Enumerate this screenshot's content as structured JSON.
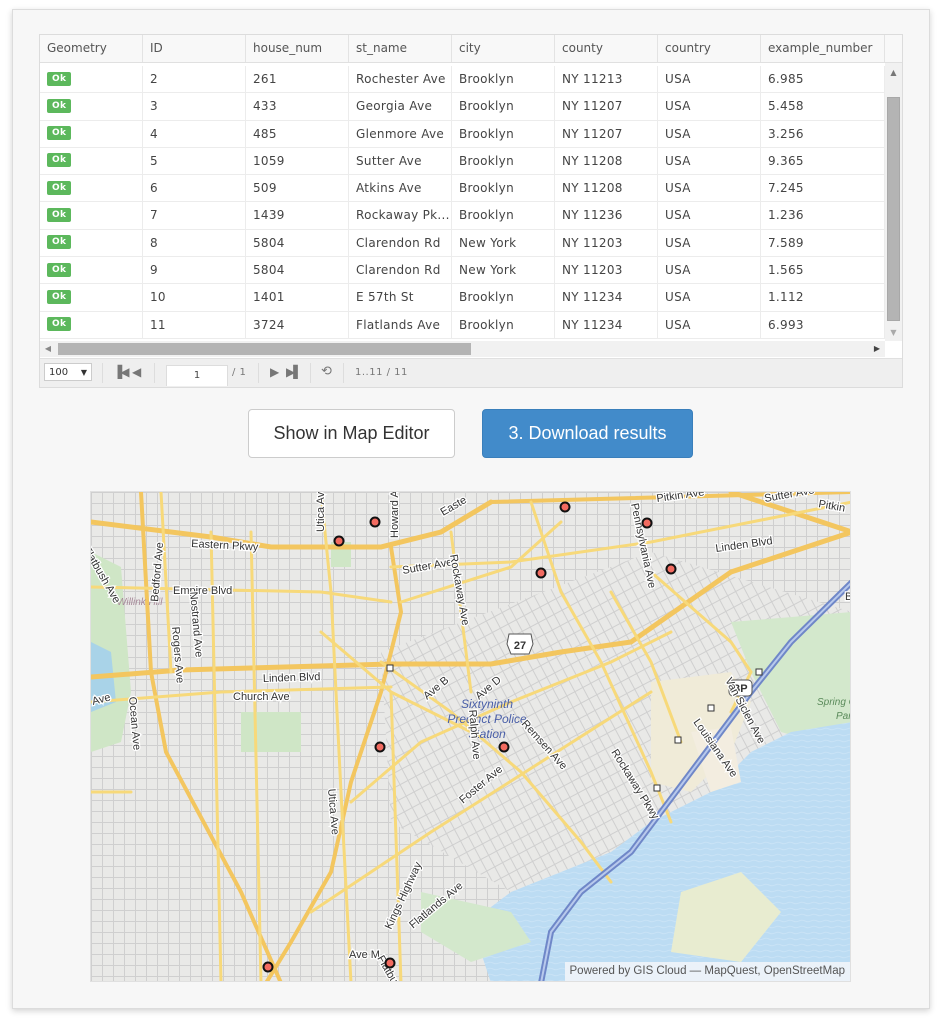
{
  "grid": {
    "columns": [
      "Geometry",
      "ID",
      "house_num",
      "st_name",
      "city",
      "county",
      "country",
      "example_number"
    ],
    "rows": [
      {
        "geometry": "Ok",
        "id": "2",
        "house_num": "261",
        "st_name": "Rochester Ave",
        "city": "Brooklyn",
        "county": "NY 11213",
        "country": "USA",
        "example_number": "6.985"
      },
      {
        "geometry": "Ok",
        "id": "3",
        "house_num": "433",
        "st_name": "Georgia Ave",
        "city": "Brooklyn",
        "county": "NY 11207",
        "country": "USA",
        "example_number": "5.458"
      },
      {
        "geometry": "Ok",
        "id": "4",
        "house_num": "485",
        "st_name": "Glenmore Ave",
        "city": "Brooklyn",
        "county": "NY 11207",
        "country": "USA",
        "example_number": "3.256"
      },
      {
        "geometry": "Ok",
        "id": "5",
        "house_num": "1059",
        "st_name": "Sutter Ave",
        "city": "Brooklyn",
        "county": "NY 11208",
        "country": "USA",
        "example_number": "9.365"
      },
      {
        "geometry": "Ok",
        "id": "6",
        "house_num": "509",
        "st_name": "Atkins Ave",
        "city": "Brooklyn",
        "county": "NY 11208",
        "country": "USA",
        "example_number": "7.245"
      },
      {
        "geometry": "Ok",
        "id": "7",
        "house_num": "1439",
        "st_name": "Rockaway Pk...",
        "city": "Brooklyn",
        "county": "NY 11236",
        "country": "USA",
        "example_number": "1.236"
      },
      {
        "geometry": "Ok",
        "id": "8",
        "house_num": "5804",
        "st_name": "Clarendon Rd",
        "city": "New York",
        "county": "NY 11203",
        "country": "USA",
        "example_number": "7.589"
      },
      {
        "geometry": "Ok",
        "id": "9",
        "house_num": "5804",
        "st_name": "Clarendon Rd",
        "city": "New York",
        "county": "NY 11203",
        "country": "USA",
        "example_number": "1.565"
      },
      {
        "geometry": "Ok",
        "id": "10",
        "house_num": "1401",
        "st_name": "E 57th St",
        "city": "Brooklyn",
        "county": "NY 11234",
        "country": "USA",
        "example_number": "1.112"
      },
      {
        "geometry": "Ok",
        "id": "11",
        "house_num": "3724",
        "st_name": "Flatlands Ave",
        "city": "Brooklyn",
        "county": "NY 11234",
        "country": "USA",
        "example_number": "6.993"
      }
    ]
  },
  "pager": {
    "page_size": "100",
    "current_page": "1",
    "total_pages": "/ 1",
    "range": "1..11 / 11"
  },
  "actions": {
    "show_map_editor": "Show in Map Editor",
    "download_results": "3. Download results"
  },
  "map": {
    "attribution": "Powered by GIS Cloud — MapQuest, OpenStreetMap",
    "labels": {
      "eastern_pkwy": "Eastern Pkwy",
      "empire_blvd": "Empire Blvd",
      "linden_blvd_w": "Linden Blvd",
      "linden_blvd_e": "Linden Blvd",
      "church_ave": "Church Ave",
      "sutter_ave": "Sutter Ave",
      "sutter_ave_e": "Sutter Ave",
      "pitkin_ave": "Pitkin Ave",
      "pitkin_e": "Pitkin",
      "willink_hill": "Willink Hill",
      "sixtyninth": "Sixtyninth",
      "precinct": "Precinct Police",
      "station": "Station",
      "spring_creek": "Spring C",
      "park": "Park",
      "route_27": "27",
      "bp": "BP",
      "bedford_ave": "Bedford Ave",
      "rogers_ave": "Rogers Ave",
      "nostrand_ave": "Nostrand Ave",
      "utica_ave_n": "Utica Ave",
      "utica_ave_s": "Utica Ave",
      "howard_ave": "Howard Ave",
      "rockaway_ave": "Rockaway Ave",
      "pennsylvania_ave": "Pennsylvania Ave",
      "van_siclen_ave": "Van Siclen Ave",
      "louisiana_ave": "Louisiana Ave",
      "rockaway_pkwy": "Rockaway Pkwy",
      "remsen_ave": "Remsen Ave",
      "ralph_ave": "Ralph Ave",
      "foster_ave": "Foster Ave",
      "flatlands_ave": "Flatlands Ave",
      "kings_highway": "Kings Highway",
      "ave_b": "Ave B",
      "ave_d": "Ave D",
      "ave_m": "Ave M",
      "flatbush": "Flatbush",
      "ocean_ave": "Ocean Ave",
      "flatbush_ave": "Flatbush Ave",
      "ave_w": "Ave",
      "eastern_e": "Easte",
      "b_e": "B"
    },
    "colors": {
      "marker_fill": "#f26b60",
      "accent_blue": "#428bca",
      "ok_green": "#5cb85c"
    }
  }
}
